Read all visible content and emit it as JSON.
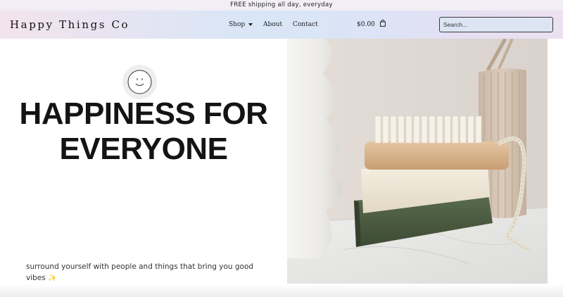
{
  "announcement": "FREE shipping all day, everyday",
  "header": {
    "logo": "Happy Things Co",
    "nav": [
      {
        "label": "Shop",
        "has_dropdown": true
      },
      {
        "label": "About"
      },
      {
        "label": "Contact"
      }
    ],
    "cart_total": "$0.00",
    "search_placeholder": "Search..."
  },
  "hero": {
    "icon": "smiley-face-icon",
    "headline_line1": "HAPPINESS FOR",
    "headline_line2": "EVERYONE",
    "tagline": "surround yourself with people and things that bring you good vibes",
    "tagline_emoji": "✨",
    "image_icon": "bath-products-photo"
  },
  "colors": {
    "header_gradient_start": "#f3e4ec",
    "header_gradient_mid": "#d8e6f6",
    "headline": "#141414",
    "announce_bg": "#f1eef5"
  }
}
